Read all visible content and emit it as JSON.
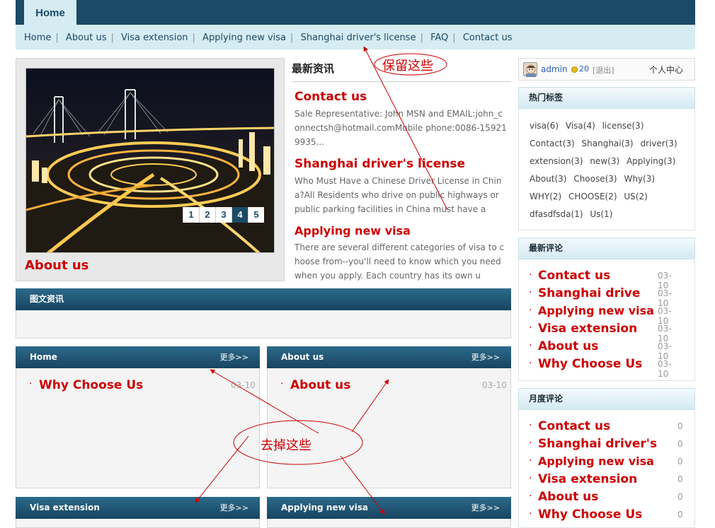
{
  "nav": {
    "home_tab": "Home",
    "links": [
      "Home",
      "About us",
      "Visa extension",
      "Applying new visa",
      "Shanghai driver's license",
      "FAQ",
      "Contact us"
    ]
  },
  "slider": {
    "pages": [
      "1",
      "2",
      "3",
      "4",
      "5"
    ],
    "active_page": "4",
    "caption": "About us"
  },
  "latest_news": {
    "title": "最新资讯",
    "items": [
      {
        "title": "Contact us",
        "summary": "Sale Representative: John          MSN and EMAIL:john_connectsh@hotmail.comMobile phone:0086-159219935..."
      },
      {
        "title": "Shanghai driver's license",
        "summary": "Who Must Have a Chinese Driver License in China?All Residents who drive on public highways or public parking facilities in China must have a"
      },
      {
        "title": "Applying new visa",
        "summary": "There are several different categories of visa to choose from--you'll need to know which you need when you apply. Each country has its own u"
      }
    ]
  },
  "picture_news": {
    "title": "图文资讯"
  },
  "category_boxes": [
    {
      "title": "Home",
      "more": "更多>>",
      "items": [
        {
          "title": "Why Choose Us",
          "date": "03-10"
        }
      ]
    },
    {
      "title": "About us",
      "more": "更多>>",
      "items": [
        {
          "title": "About us",
          "date": "03-10"
        }
      ]
    },
    {
      "title": "Visa extension",
      "more": "更多>>"
    },
    {
      "title": "Applying new visa",
      "more": "更多>>"
    }
  ],
  "user": {
    "name": "admin",
    "points": "20",
    "logout": "[退出]",
    "center": "个人中心"
  },
  "hot_tags": {
    "title": "热门标签",
    "tags": [
      "visa(6)",
      "Visa(4)",
      "license(3)",
      "Contact(3)",
      "Shanghai(3)",
      "driver(3)",
      "extension(3)",
      "new(3)",
      "Applying(3)",
      "About(3)",
      "Choose(3)",
      "Why(3)",
      "WHY(2)",
      "CHOOSE(2)",
      "US(2)",
      "dfasdfsda(1)",
      "Us(1)"
    ]
  },
  "latest_comments": {
    "title": "最新评论",
    "items": [
      {
        "title": "Contact us",
        "date": "03-10"
      },
      {
        "title": "Shanghai drive",
        "date": "03-10"
      },
      {
        "title": "Applying new visa",
        "date": "03-10"
      },
      {
        "title": "Visa extension",
        "date": "03-10"
      },
      {
        "title": "About us",
        "date": "03-10"
      },
      {
        "title": "Why Choose Us",
        "date": "03-10"
      }
    ]
  },
  "monthly_comments": {
    "title": "月度评论",
    "items": [
      {
        "title": "Contact us",
        "count": "0"
      },
      {
        "title": "Shanghai driver's",
        "count": "0"
      },
      {
        "title": "Applying new visa",
        "count": "0"
      },
      {
        "title": "Visa extension",
        "count": "0"
      },
      {
        "title": "About us",
        "count": "0"
      },
      {
        "title": "Why Choose Us",
        "count": "0"
      }
    ]
  },
  "annotations": {
    "keep": "保留这些",
    "remove": "去掉这些",
    "color": "#cc0000"
  }
}
